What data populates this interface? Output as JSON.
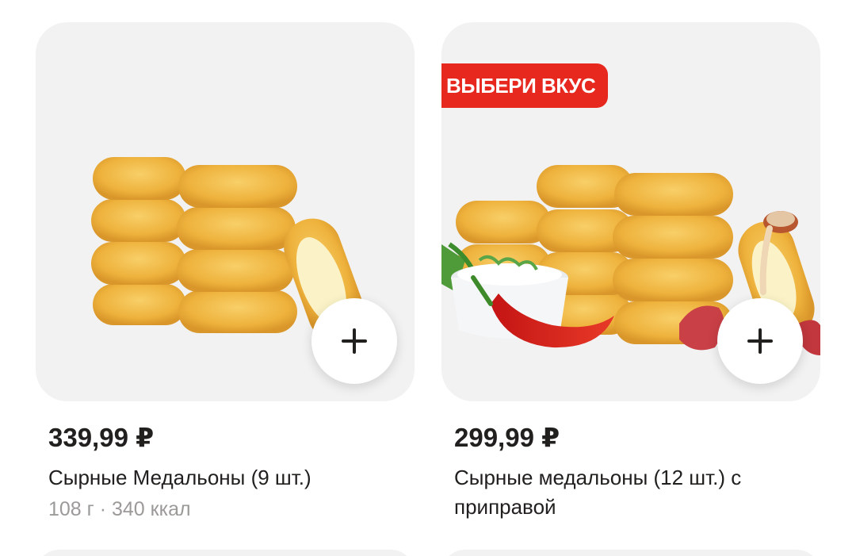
{
  "products": [
    {
      "price": "339,99 ₽",
      "title": "Сырные Медальоны (9 шт.)",
      "meta": "108 г · 340 ккал",
      "badge": "",
      "add_icon": "plus-icon"
    },
    {
      "price": "299,99 ₽",
      "title": "Сырные медальоны (12 шт.) с приправой",
      "meta": "",
      "badge": "ВЫБЕРИ ВКУС",
      "add_icon": "plus-icon"
    }
  ],
  "colors": {
    "badge_bg": "#e7281f",
    "card_bg": "#f2f2f2",
    "price_text": "#21201f",
    "meta_text": "#9b9a98",
    "nugget": "#f1b542"
  }
}
